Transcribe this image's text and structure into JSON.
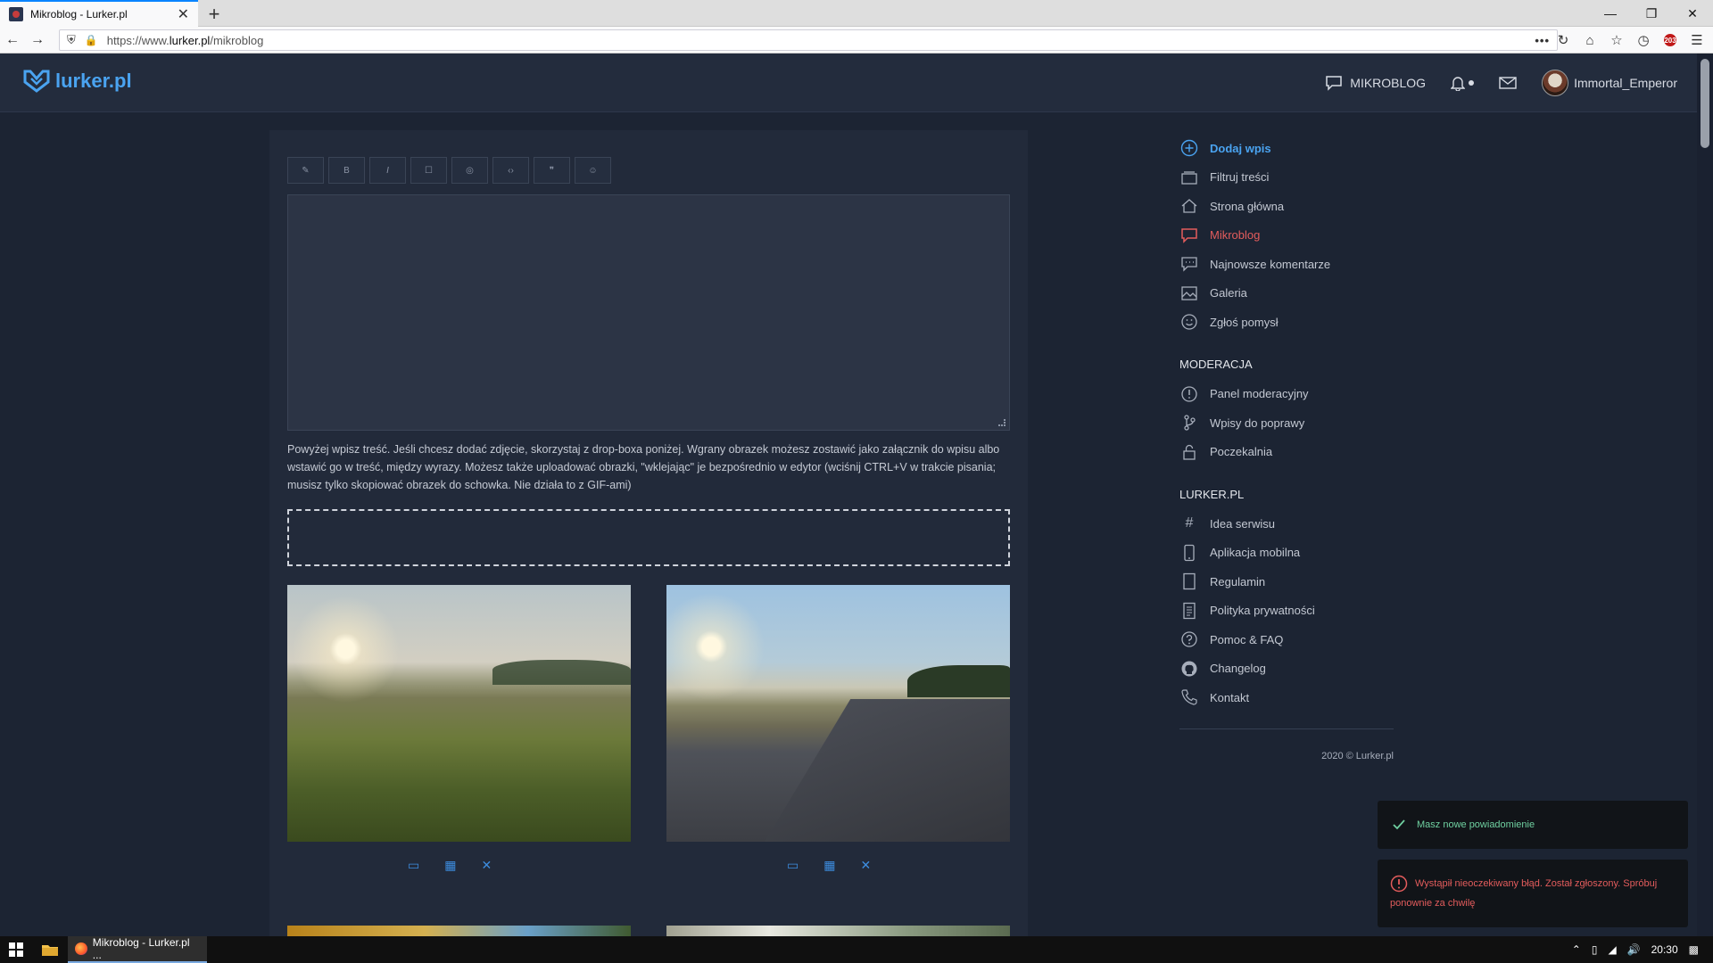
{
  "browser": {
    "tab_title": "Mikroblog - Lurker.pl",
    "tab_close": "✕",
    "new_tab": "+",
    "url_scheme": "https://www.",
    "url_host": "lurker.pl",
    "url_path": "/mikroblog",
    "url_more": "•••",
    "ext_badge": "203"
  },
  "header": {
    "logo_text": "lurker.pl",
    "nav_mikroblog": "MIKROBLOG",
    "username": "Immortal_Emperor"
  },
  "editor": {
    "toolbar": [
      "✎",
      "B",
      "I",
      "☐",
      "◎",
      "‹›",
      "❞",
      "☺"
    ],
    "help_text": "Powyżej wpisz treść. Jeśli chcesz dodać zdjęcie, skorzystaj z drop-boxa poniżej. Wgrany obrazek możesz zostawić jako załącznik do wpisu albo wstawić go w treść, między wyrazy. Możesz także uploadować obrazki, \"wklejając\" je bezpośrednio w edytor (wciśnij CTRL+V w trakcie pisania; musisz tylko skopiować obrazek do schowka. Nie działa to z GIF-ami)"
  },
  "sidebar": {
    "main": [
      {
        "label": "Dodaj wpis",
        "icon": "plus-circle-icon"
      },
      {
        "label": "Filtruj treści",
        "icon": "filter-icon"
      },
      {
        "label": "Strona główna",
        "icon": "home-icon"
      },
      {
        "label": "Mikroblog",
        "icon": "chat-icon"
      },
      {
        "label": "Najnowsze komentarze",
        "icon": "comments-icon"
      },
      {
        "label": "Galeria",
        "icon": "image-icon"
      },
      {
        "label": "Zgłoś pomysł",
        "icon": "smile-icon"
      }
    ],
    "moderation_heading": "MODERACJA",
    "moderation": [
      {
        "label": "Panel moderacyjny",
        "icon": "alert-icon"
      },
      {
        "label": "Wpisy do poprawy",
        "icon": "branch-icon"
      },
      {
        "label": "Poczekalnia",
        "icon": "lock-icon"
      }
    ],
    "site_heading": "LURKER.PL",
    "site": [
      {
        "label": "Idea serwisu",
        "icon": "hash-icon"
      },
      {
        "label": "Aplikacja mobilna",
        "icon": "phone-icon"
      },
      {
        "label": "Regulamin",
        "icon": "document-icon"
      },
      {
        "label": "Polityka prywatności",
        "icon": "list-document-icon"
      },
      {
        "label": "Pomoc & FAQ",
        "icon": "question-icon"
      },
      {
        "label": "Changelog",
        "icon": "github-icon"
      },
      {
        "label": "Kontakt",
        "icon": "phone-handset-icon"
      }
    ],
    "footer": "2020 © Lurker.pl"
  },
  "toasts": {
    "success": "Masz nowe powiadomienie",
    "error": "Wystąpił nieoczekiwany błąd. Został zgłoszony. Spróbuj ponownie za chwilę"
  },
  "taskbar": {
    "app_label": "Mikroblog - Lurker.pl ...",
    "clock": "20:30"
  },
  "colors": {
    "background": "#1c2433",
    "panel": "#222a3a",
    "accent_blue": "#4aa3f0",
    "active_red": "#e35c5c",
    "success_green": "#6fd0a0"
  }
}
